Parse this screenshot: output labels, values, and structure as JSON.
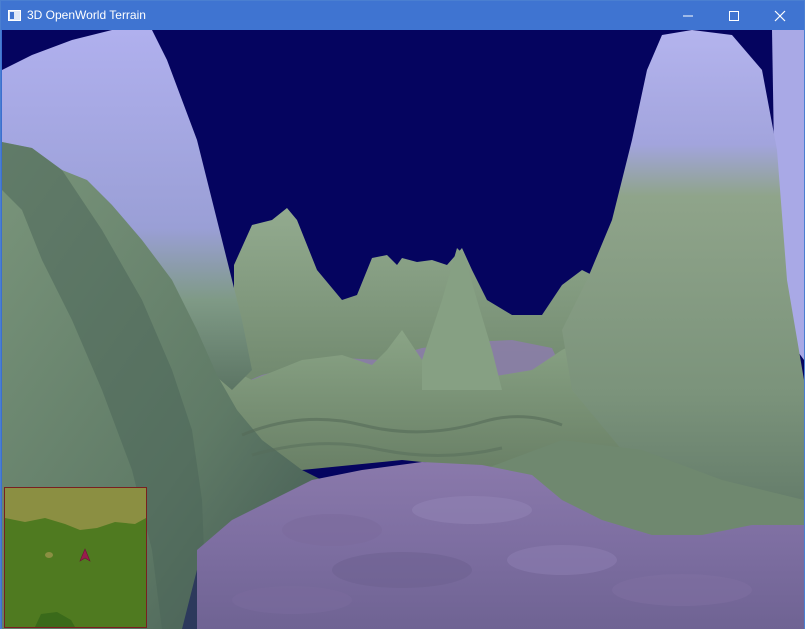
{
  "window": {
    "title": "3D OpenWorld Terrain",
    "app_icon": "window-app-icon",
    "controls": [
      {
        "name": "minimize-button",
        "icon": "minimize-icon"
      },
      {
        "name": "maximize-button",
        "icon": "maximize-icon"
      },
      {
        "name": "close-button",
        "icon": "close-icon"
      }
    ]
  },
  "scene": {
    "sky_color": "#05045f",
    "terrain_colors": {
      "grass": "#7f9b7f",
      "grass_dark": "#52685a",
      "snow": "#a9a9e6",
      "purple_sand": "#8b79aa"
    }
  },
  "minimap": {
    "ground_color": "#4f7a20",
    "highland_color": "#8b8f42",
    "border_color": "#7a1f1f",
    "player_marker_icon": "player-arrow-icon",
    "player_marker_color": "#9a1d4e"
  }
}
